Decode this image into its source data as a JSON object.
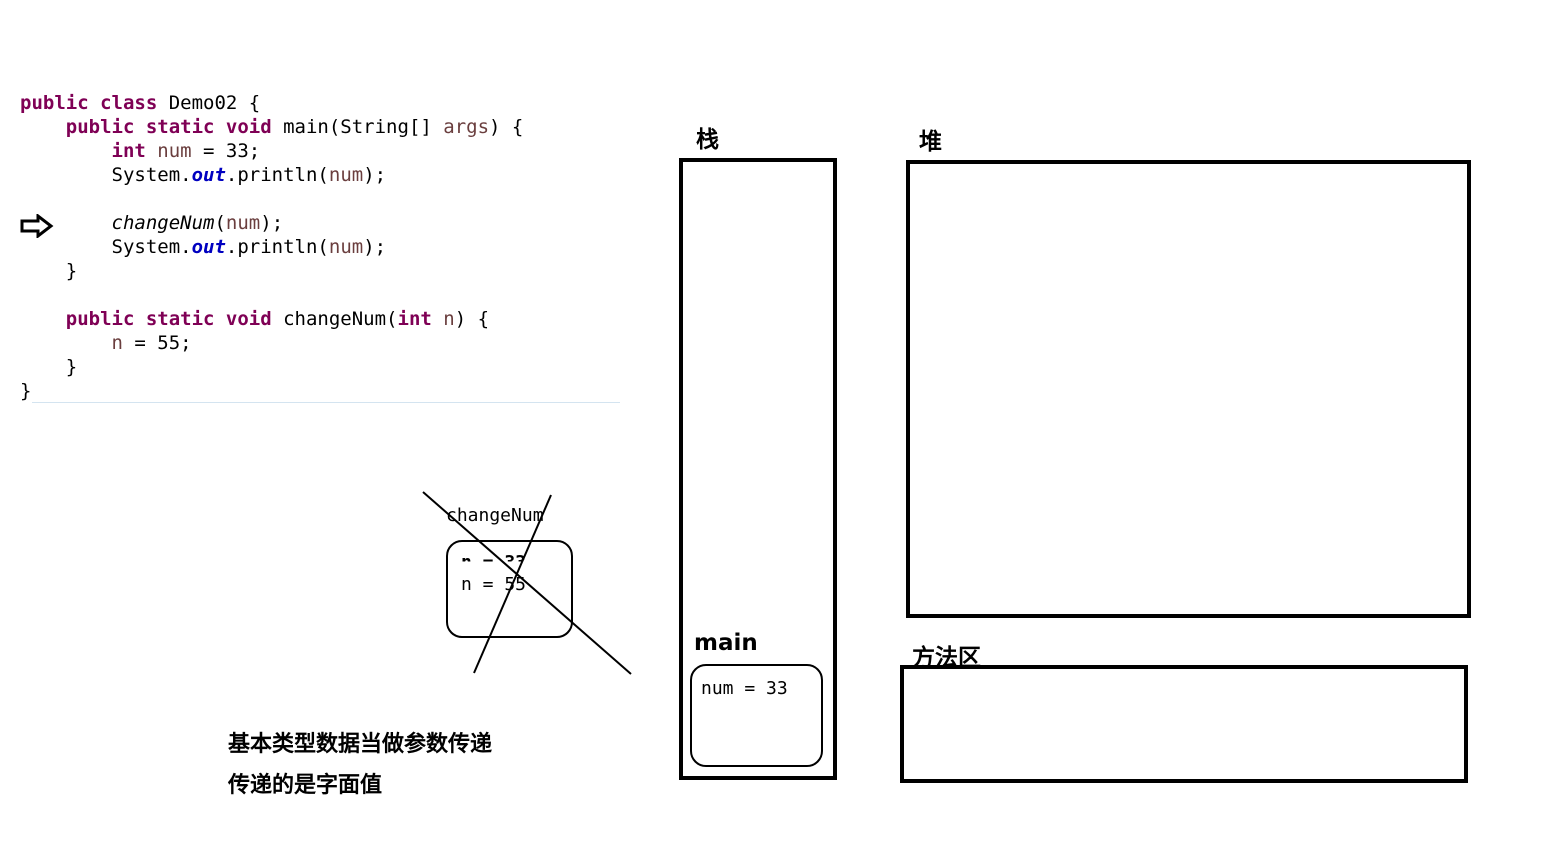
{
  "code": {
    "lines": [
      [
        {
          "t": "public class ",
          "c": "kw"
        },
        {
          "t": "Demo02 {",
          "c": ""
        }
      ],
      [
        {
          "t": "    ",
          "c": ""
        },
        {
          "t": "public static void ",
          "c": "kw"
        },
        {
          "t": "main(String[] ",
          "c": ""
        },
        {
          "t": "args",
          "c": "var"
        },
        {
          "t": ") {",
          "c": ""
        }
      ],
      [
        {
          "t": "        ",
          "c": ""
        },
        {
          "t": "int ",
          "c": "kw"
        },
        {
          "t": "num",
          "c": "var"
        },
        {
          "t": " = 33;",
          "c": ""
        }
      ],
      [
        {
          "t": "        System.",
          "c": ""
        },
        {
          "t": "out",
          "c": "fld"
        },
        {
          "t": ".println(",
          "c": ""
        },
        {
          "t": "num",
          "c": "var"
        },
        {
          "t": ");",
          "c": ""
        }
      ],
      [],
      [
        {
          "t": "        ",
          "c": ""
        },
        {
          "t": "changeNum",
          "c": "it"
        },
        {
          "t": "(",
          "c": ""
        },
        {
          "t": "num",
          "c": "var"
        },
        {
          "t": ");",
          "c": ""
        }
      ],
      [
        {
          "t": "        System.",
          "c": ""
        },
        {
          "t": "out",
          "c": "fld"
        },
        {
          "t": ".println(",
          "c": ""
        },
        {
          "t": "num",
          "c": "var"
        },
        {
          "t": ");",
          "c": ""
        }
      ],
      [
        {
          "t": "    }",
          "c": ""
        }
      ],
      [],
      [
        {
          "t": "    ",
          "c": ""
        },
        {
          "t": "public static void ",
          "c": "kw"
        },
        {
          "t": "changeNum(",
          "c": ""
        },
        {
          "t": "int ",
          "c": "kw"
        },
        {
          "t": "n",
          "c": "var"
        },
        {
          "t": ") {",
          "c": ""
        }
      ],
      [
        {
          "t": "        ",
          "c": ""
        },
        {
          "t": "n",
          "c": "var"
        },
        {
          "t": " = 55;",
          "c": ""
        }
      ],
      [
        {
          "t": "    }",
          "c": ""
        }
      ],
      [
        {
          "t": "}",
          "c": ""
        }
      ]
    ]
  },
  "labels": {
    "stack": "栈",
    "heap": "堆",
    "method_area": "方法区",
    "main_frame": "main",
    "main_var": "num = 33",
    "change_frame": "changeNum",
    "change_old_var": "n = 33",
    "change_new_var": "n = 55",
    "note_line1": "基本类型数据当做参数传递",
    "note_line2": "传递的是字面值"
  },
  "icons": {
    "current_line_marker": "arrow-right-icon"
  }
}
